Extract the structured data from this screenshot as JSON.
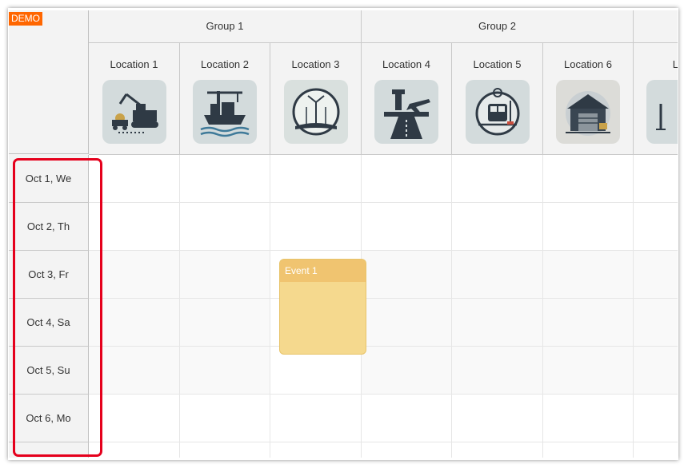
{
  "badge": "DEMO",
  "groups": [
    {
      "label": "Group 1"
    },
    {
      "label": "Group 2"
    },
    {
      "label": ""
    }
  ],
  "locations": [
    {
      "label": "Location 1",
      "icon": "construction-icon"
    },
    {
      "label": "Location 2",
      "icon": "port-icon"
    },
    {
      "label": "Location 3",
      "icon": "wind-farm-icon"
    },
    {
      "label": "Location 4",
      "icon": "airport-icon"
    },
    {
      "label": "Location 5",
      "icon": "train-station-icon"
    },
    {
      "label": "Location 6",
      "icon": "warehouse-icon"
    },
    {
      "label": "Lo",
      "icon": "tower-icon"
    }
  ],
  "rows": [
    {
      "label": "Oct 1, We"
    },
    {
      "label": "Oct 2, Th"
    },
    {
      "label": "Oct 3, Fr"
    },
    {
      "label": "Oct 4, Sa"
    },
    {
      "label": "Oct 5, Su"
    },
    {
      "label": "Oct 6, Mo"
    }
  ],
  "events": [
    {
      "text": "Event 1",
      "location": "Location 3",
      "start": "Oct 3, Fr",
      "end": "Oct 4, Sa"
    }
  ],
  "colors": {
    "badge": "#ff6600",
    "event_body": "#f5d98e",
    "event_bar": "#f0c470",
    "highlight": "#e5001c"
  }
}
